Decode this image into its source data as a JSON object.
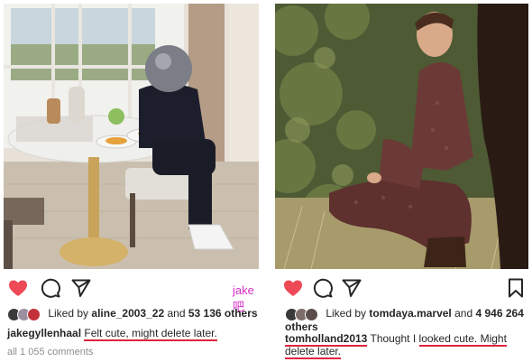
{
  "left_post": {
    "liked_by_prefix": "Liked by",
    "liked_by_user": "aline_2003_22",
    "and_word": "and",
    "others_count": "53 136 others",
    "username": "jakegyllenhaal",
    "caption": "Felt cute, might delete later.",
    "comments": "all 1 055 comments",
    "icons": [
      "heart-icon",
      "comment-icon",
      "share-icon"
    ]
  },
  "right_post": {
    "liked_by_prefix": "Liked by",
    "liked_by_user": "tomdaya.marvel",
    "and_word": "and",
    "others_count": "4 946 264",
    "others_word": "others",
    "username": "tomholland2013",
    "caption_before": "Thought I",
    "caption_highlight": "looked cute. Might delete later.",
    "icons": [
      "heart-icon",
      "comment-icon",
      "share-icon",
      "bookmark-icon"
    ]
  },
  "watermark": "jake吧",
  "colors": {
    "heart": "#ed4956",
    "underline": "#e0243b",
    "watermark": "#d930c8"
  }
}
